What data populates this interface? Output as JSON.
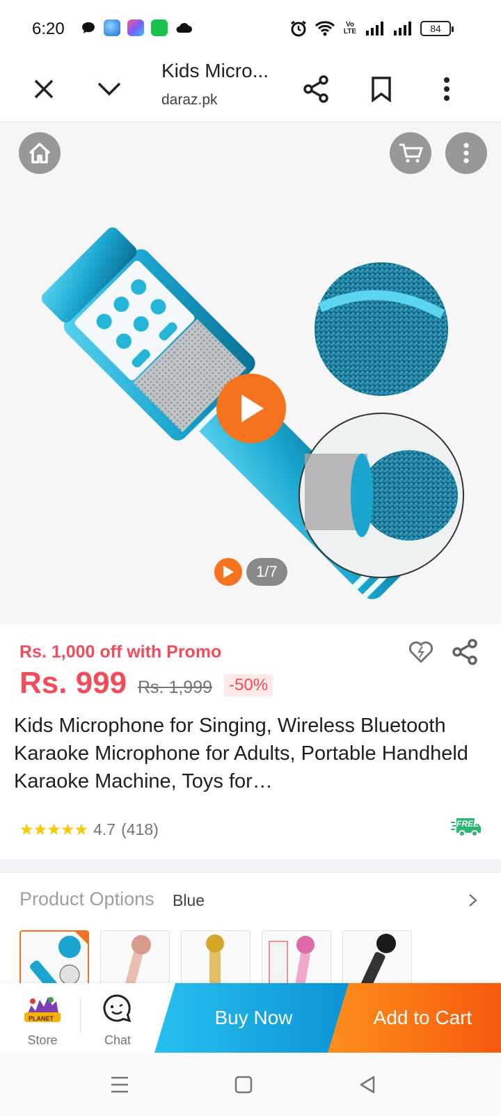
{
  "status_bar": {
    "time": "6:20",
    "battery": "84",
    "network_label": "Vo LTE"
  },
  "toolbar": {
    "title": "Kids Micro...",
    "url": "daraz.pk"
  },
  "gallery": {
    "counter": "1/7"
  },
  "product": {
    "promo": "Rs. 1,000 off with Promo",
    "price": "Rs. 999",
    "old_price": "Rs. 1,999",
    "discount": "-50%",
    "title": "Kids Microphone for Singing, Wireless Bluetooth Karaoke Microphone for Adults, Portable Handheld Karaoke Machine, Toys for…",
    "rating_value": "4.7",
    "rating_count": "(418)",
    "free_badge": "FREE"
  },
  "options": {
    "label": "Product Options",
    "value": "Blue",
    "thumbnails": [
      {
        "color": "#1aa6cf"
      },
      {
        "color": "#d89a8a"
      },
      {
        "color": "#d4a62a"
      },
      {
        "color": "#e06aa8"
      },
      {
        "color": "#1b1b1b"
      }
    ]
  },
  "action_bar": {
    "store_label": "Store",
    "store_logo_text": "PLANET",
    "chat_label": "Chat",
    "buy_now": "Buy Now",
    "add_to_cart": "Add to Cart"
  },
  "colors": {
    "price_red": "#f24c5a",
    "daraz_orange": "#f57224",
    "buy_now_blue": "#0a92d4",
    "star_yellow": "#faca00",
    "free_green": "#2bb673"
  }
}
